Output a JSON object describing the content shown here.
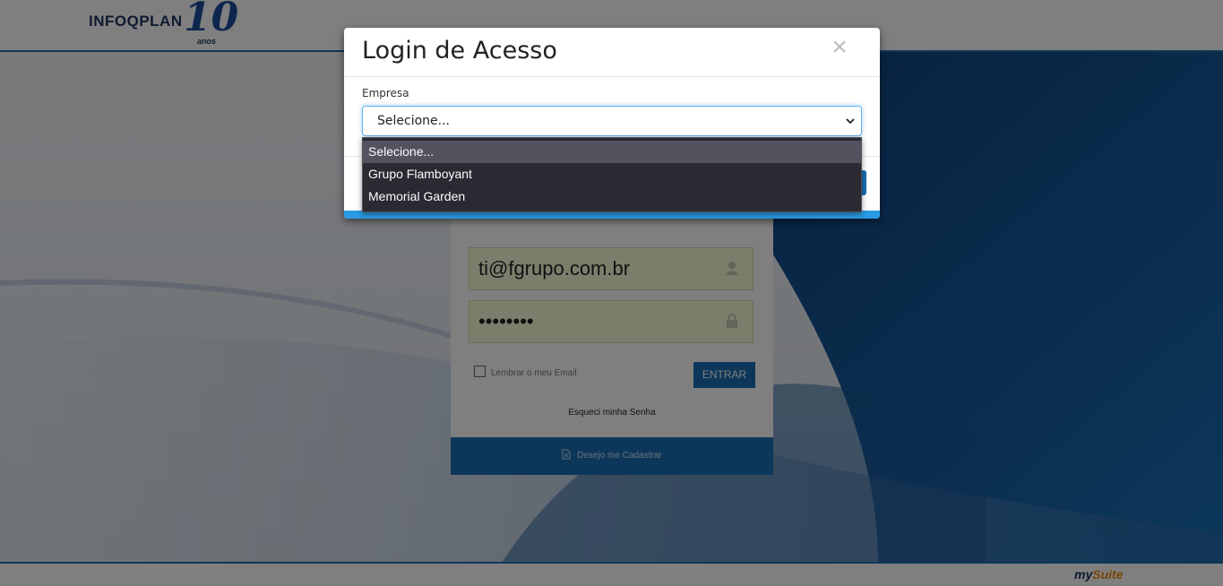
{
  "header": {
    "logo_text": "INFOQPLAN",
    "logo_number": "10",
    "logo_suffix": "anos"
  },
  "login_card": {
    "email_value": "ti@fgrupo.com.br",
    "password_value": "••••••••",
    "remember_label": "Lembrar o meu Email",
    "submit_label": "ENTRAR",
    "forgot_label": "Esqueci minha Senha",
    "register_label": "Desejo me Cadastrar"
  },
  "modal": {
    "title": "Login de Acesso",
    "close_symbol": "×",
    "field_label": "Empresa",
    "select_value": "Selecione...",
    "options": [
      "Selecione...",
      "Grupo Flamboyant",
      "Memorial Garden"
    ],
    "selected_index": 0
  },
  "footer": {
    "brand_my": "my",
    "brand_suite": "Suite"
  },
  "colors": {
    "accent": "#1a6fb5",
    "modal_bottom_bar": "#2a9ae4",
    "dropdown_bg": "#2b2a33",
    "brand_orange": "#f08a12"
  },
  "icons": [
    "close-icon",
    "chevron-down-icon",
    "user-icon",
    "lock-icon",
    "document-icon"
  ]
}
